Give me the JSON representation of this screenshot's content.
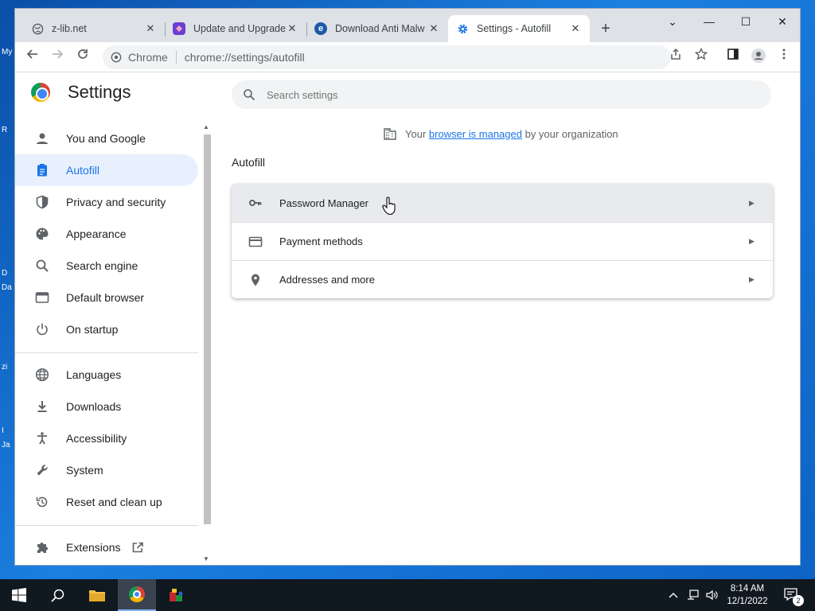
{
  "desktop": {
    "icon_labels": [
      "My",
      "R",
      "D",
      "Da",
      "zi",
      "I",
      "Ja"
    ]
  },
  "browser": {
    "tabs": [
      {
        "title": "z-lib.net",
        "favicon": "globe-icon",
        "active": false
      },
      {
        "title": "Update and Upgrade",
        "favicon": "app-icon",
        "active": false
      },
      {
        "title": "Download Anti Malw",
        "favicon": "edge-e-icon",
        "active": false
      },
      {
        "title": "Settings - Autofill",
        "favicon": "gear-icon",
        "active": true
      }
    ],
    "new_tab": "+",
    "window_controls": {
      "tab_search": "⌄",
      "minimize": "—",
      "maximize": "☐",
      "close": "✕"
    },
    "toolbar": {
      "site_label": "Chrome",
      "url": "chrome://settings/autofill"
    }
  },
  "settings": {
    "title": "Settings",
    "search_placeholder": "Search settings",
    "managed_prefix": "Your",
    "managed_link": "browser is managed",
    "managed_suffix": "by your organization",
    "nav_items": [
      {
        "label": "You and Google",
        "icon": "person-icon"
      },
      {
        "label": "Autofill",
        "icon": "clipboard-icon",
        "selected": true
      },
      {
        "label": "Privacy and security",
        "icon": "shield-icon"
      },
      {
        "label": "Appearance",
        "icon": "palette-icon"
      },
      {
        "label": "Search engine",
        "icon": "search-icon"
      },
      {
        "label": "Default browser",
        "icon": "browser-icon"
      },
      {
        "label": "On startup",
        "icon": "power-icon"
      },
      {
        "label": "Languages",
        "icon": "globe-icon"
      },
      {
        "label": "Downloads",
        "icon": "download-icon"
      },
      {
        "label": "Accessibility",
        "icon": "accessibility-icon"
      },
      {
        "label": "System",
        "icon": "wrench-icon"
      },
      {
        "label": "Reset and clean up",
        "icon": "reset-icon"
      },
      {
        "label": "Extensions",
        "icon": "puzzle-icon"
      }
    ],
    "section_title": "Autofill",
    "rows": [
      {
        "label": "Password Manager",
        "icon": "key-icon"
      },
      {
        "label": "Payment methods",
        "icon": "credit-card-icon"
      },
      {
        "label": "Addresses and more",
        "icon": "location-pin-icon"
      }
    ]
  },
  "taskbar": {
    "time": "8:14 AM",
    "date": "12/1/2022",
    "notification_count": "2"
  }
}
